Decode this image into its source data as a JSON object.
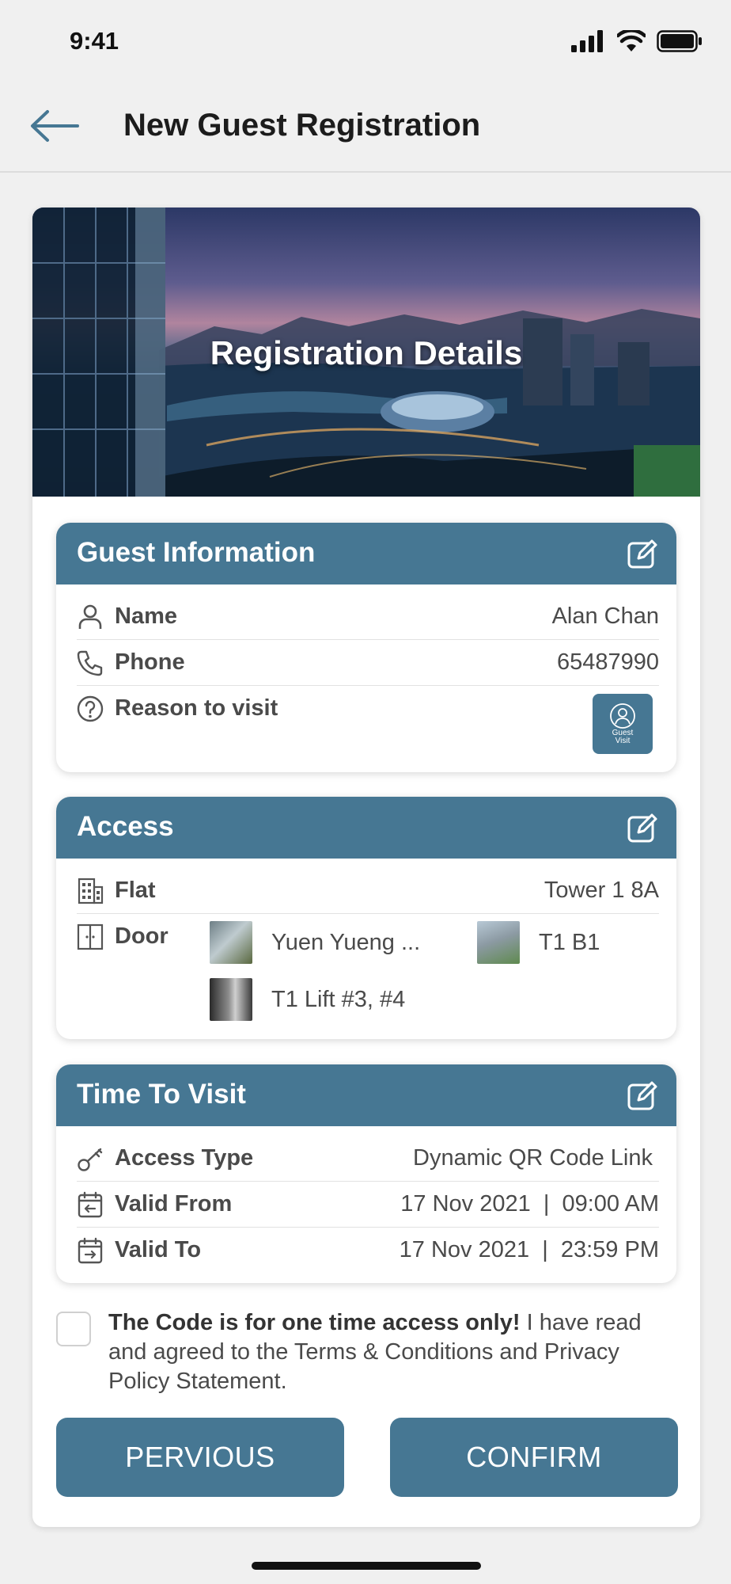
{
  "status_bar": {
    "time": "9:41"
  },
  "header": {
    "title": "New Guest Registration"
  },
  "hero": {
    "title": "Registration Details"
  },
  "guest_info": {
    "title": "Guest Information",
    "rows": [
      {
        "label": "Name",
        "value": "Alan Chan"
      },
      {
        "label": "Phone",
        "value": "65487990"
      },
      {
        "label": "Reason to visit"
      }
    ],
    "reason_button": {
      "line1": "Guest",
      "line2": "Visit"
    }
  },
  "access": {
    "title": "Access",
    "flat": {
      "label": "Flat",
      "value": "Tower 1 8A"
    },
    "door": {
      "label": "Door",
      "items": [
        "Yuen Yueng ...",
        "T1 B1",
        "T1 Lift #3, #4"
      ]
    }
  },
  "time_to_visit": {
    "title": "Time To Visit",
    "rows": [
      {
        "label": "Access Type",
        "value": "Dynamic QR Code Link"
      },
      {
        "label": "Valid From",
        "value": "17 Nov 2021  |  09:00 AM"
      },
      {
        "label": "Valid To",
        "value": "17 Nov 2021  |  23:59 PM"
      }
    ]
  },
  "terms": {
    "checked": false,
    "bold_text": "The Code is for one time access only!",
    "text": " I have read and agreed to the Terms & Conditions and Privacy Policy Statement."
  },
  "buttons": {
    "previous": "PERVIOUS",
    "confirm": "CONFIRM"
  },
  "colors": {
    "accent": "#467793",
    "background": "#f0f0f0"
  }
}
